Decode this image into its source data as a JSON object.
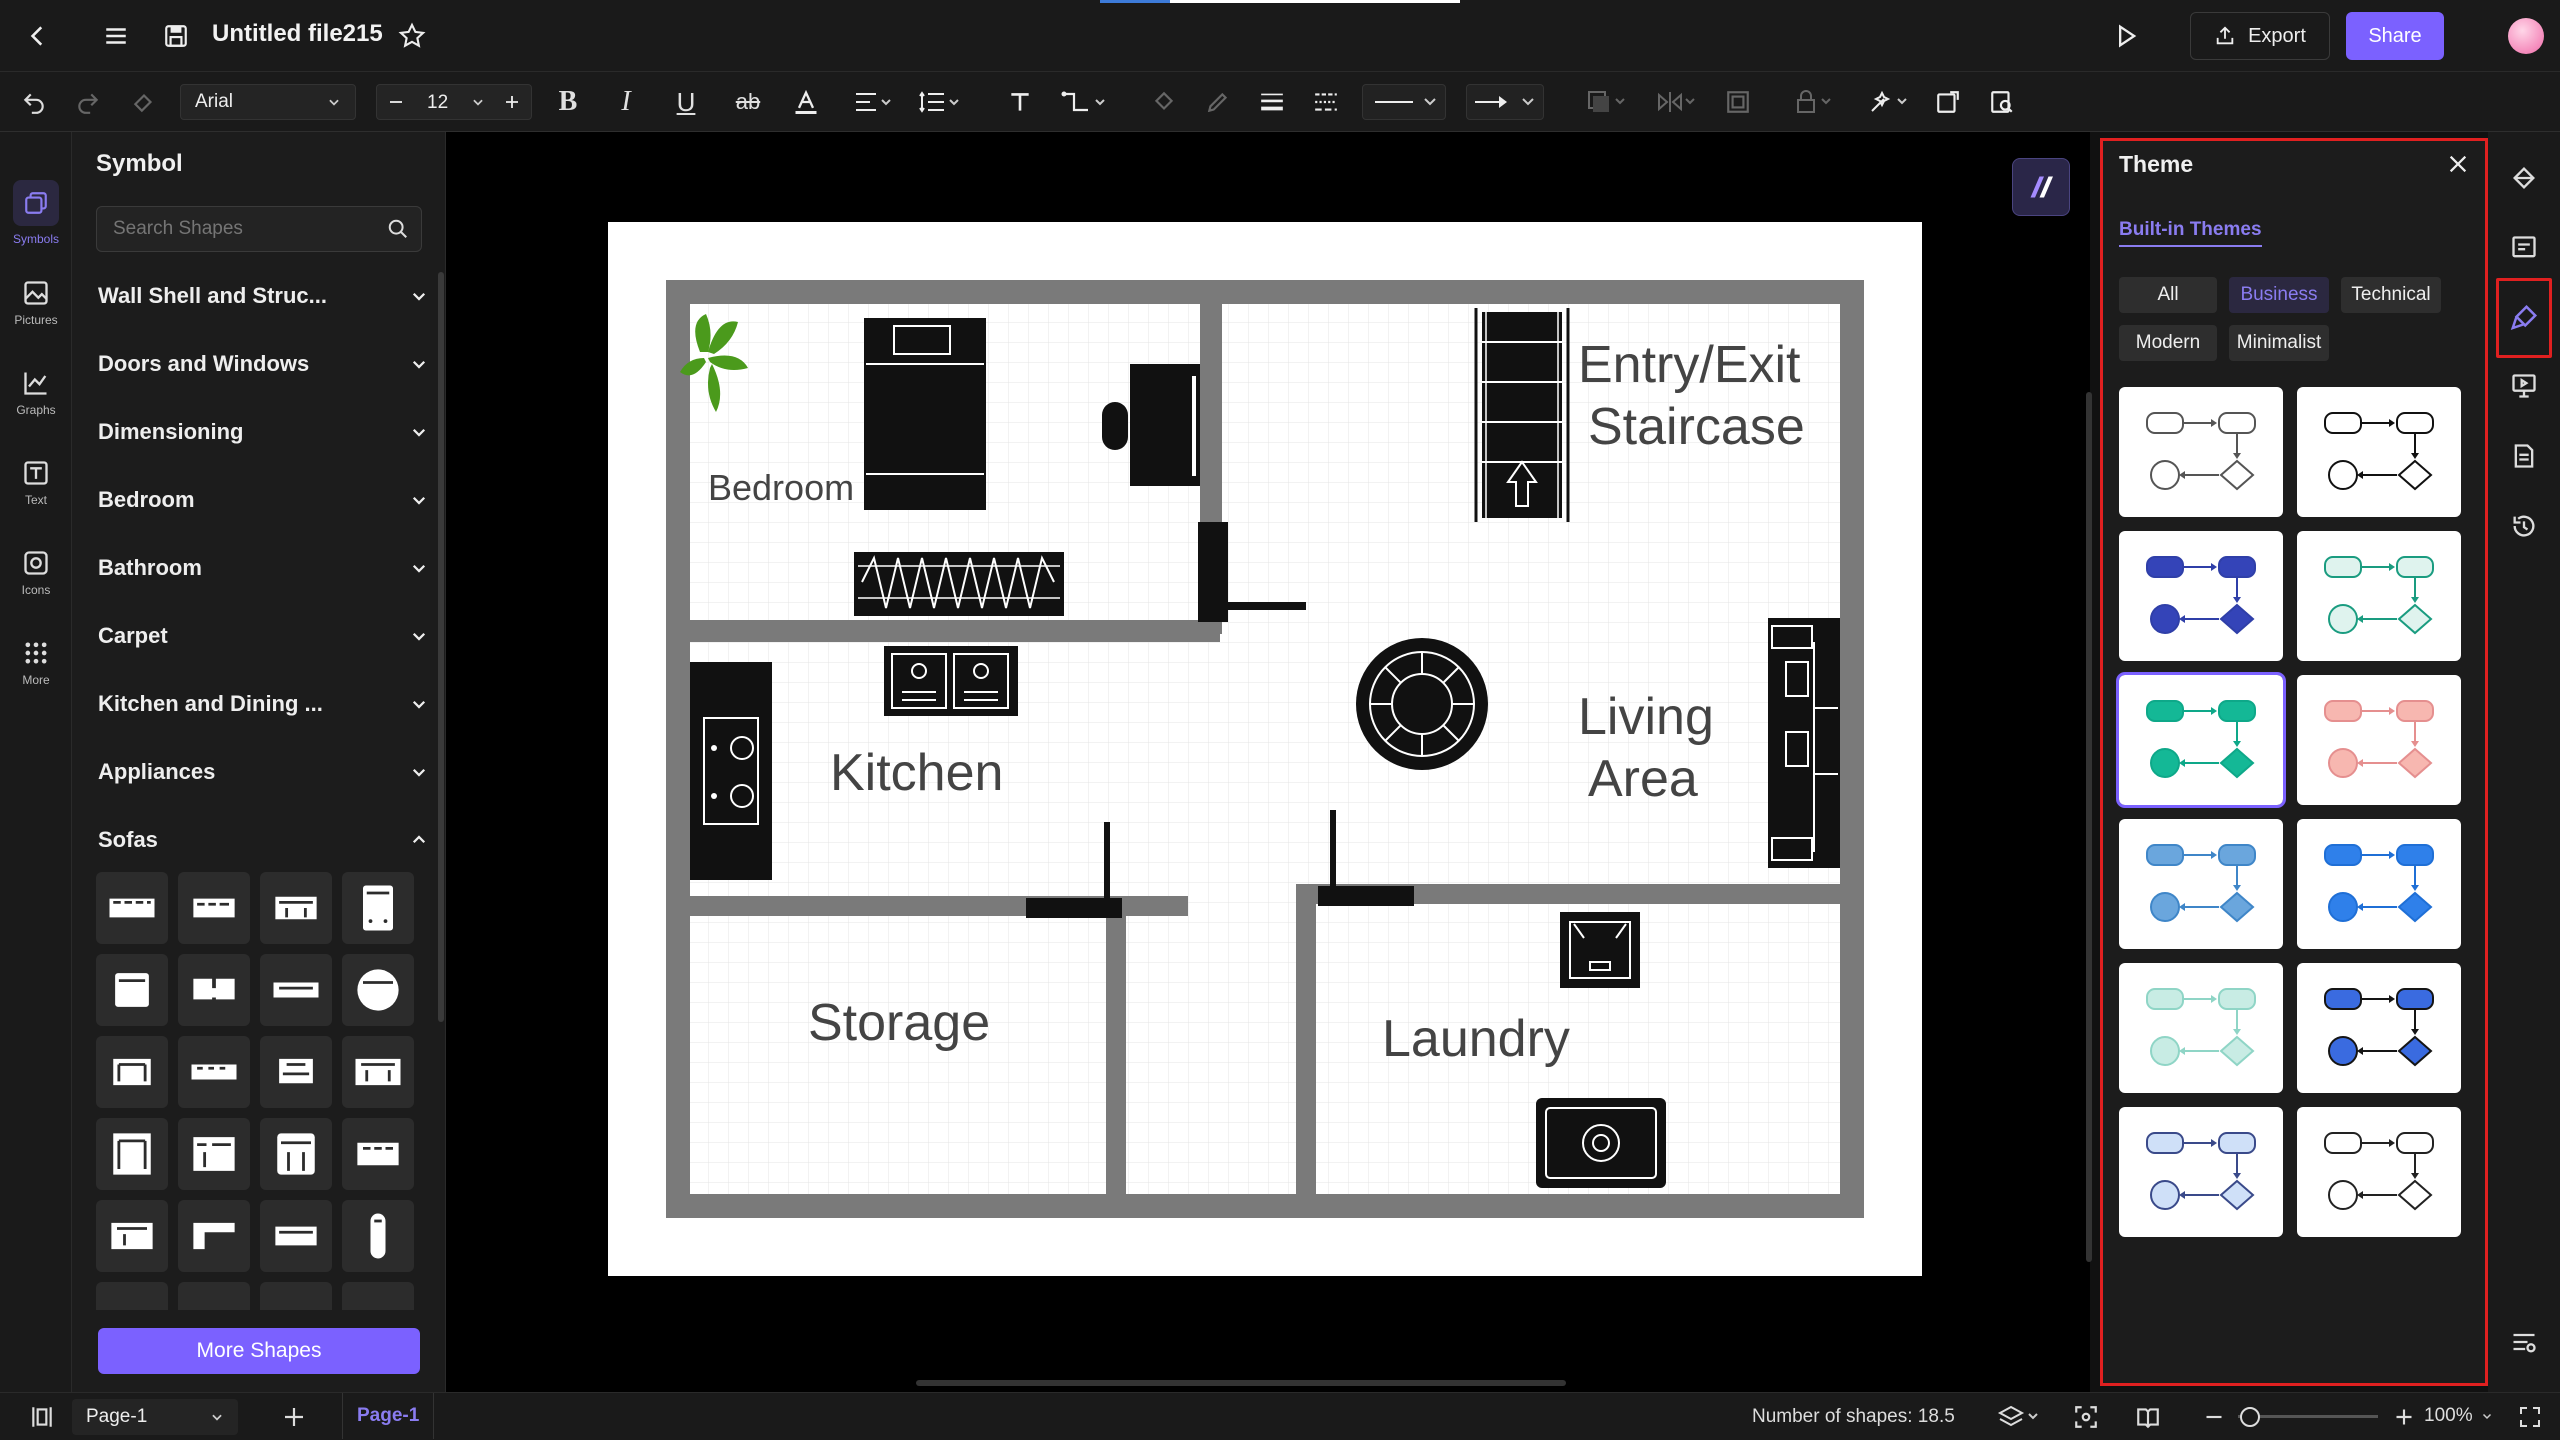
{
  "titlebar": {
    "file_name": "Untitled file215",
    "export_label": "Export",
    "share_label": "Share"
  },
  "toolbar": {
    "font_family": "Arial",
    "font_size": "12"
  },
  "left_rail": [
    {
      "label": "Symbols",
      "icon": "symbols-icon",
      "active": true
    },
    {
      "label": "Pictures",
      "icon": "pictures-icon"
    },
    {
      "label": "Graphs",
      "icon": "graphs-icon"
    },
    {
      "label": "Text",
      "icon": "text-icon"
    },
    {
      "label": "Icons",
      "icon": "icons-icon"
    },
    {
      "label": "More",
      "icon": "more-icon"
    }
  ],
  "symbol_panel": {
    "title": "Symbol",
    "search_placeholder": "Search Shapes",
    "categories": [
      {
        "label": "Wall Shell and Struc...",
        "expanded": false
      },
      {
        "label": "Doors and Windows",
        "expanded": false
      },
      {
        "label": "Dimensioning",
        "expanded": false
      },
      {
        "label": "Bedroom",
        "expanded": false
      },
      {
        "label": "Bathroom",
        "expanded": false
      },
      {
        "label": "Carpet",
        "expanded": false
      },
      {
        "label": "Kitchen and Dining ...",
        "expanded": false
      },
      {
        "label": "Appliances",
        "expanded": false
      },
      {
        "label": "Sofas",
        "expanded": true
      }
    ],
    "more_shapes_label": "More Shapes"
  },
  "canvas": {
    "rooms": [
      "Bedroom",
      "Kitchen",
      "Storage",
      "Laundry"
    ],
    "entry_line1": "Entry/Exit",
    "entry_line2": "Staircase",
    "living_line1": "Living",
    "living_line2": "Area"
  },
  "theme_panel": {
    "title": "Theme",
    "tab": "Built-in Themes",
    "filters": [
      {
        "label": "All",
        "active": false
      },
      {
        "label": "Business",
        "active": true
      },
      {
        "label": "Technical",
        "active": false
      },
      {
        "label": "Modern",
        "active": false
      },
      {
        "label": "Minimalist",
        "active": false
      }
    ],
    "themes": [
      {
        "stroke": "#555555",
        "fill": "#ffffff",
        "selected": false
      },
      {
        "stroke": "#111111",
        "fill": "#ffffff",
        "selected": false
      },
      {
        "stroke": "#2f3fa8",
        "fill": "#3444b8",
        "selected": false
      },
      {
        "stroke": "#1a9c80",
        "fill": "#dff3ee",
        "selected": false
      },
      {
        "stroke": "#0ea889",
        "fill": "#14b896",
        "selected": true
      },
      {
        "stroke": "#e58f8f",
        "fill": "#f7b7b0",
        "selected": false
      },
      {
        "stroke": "#3f86c8",
        "fill": "#6aa6dd",
        "selected": false
      },
      {
        "stroke": "#1f6fd6",
        "fill": "#2f80ea",
        "selected": false
      },
      {
        "stroke": "#8fd5c6",
        "fill": "#c8ece4",
        "selected": false
      },
      {
        "stroke": "#151515",
        "fill": "#3a6be0",
        "selected": false
      },
      {
        "stroke": "#3a4a8a",
        "fill": "#cfe0f8",
        "selected": false
      },
      {
        "stroke": "#222222",
        "fill": "#ffffff",
        "selected": false
      }
    ]
  },
  "statusbar": {
    "page_select": "Page-1",
    "page_tab": "Page-1",
    "shape_count": "Number of shapes: 18.5",
    "zoom": "100%"
  },
  "colors": {
    "accent": "#7b61ff",
    "highlight_border": "#e02020",
    "wall": "#7a7a7a"
  }
}
